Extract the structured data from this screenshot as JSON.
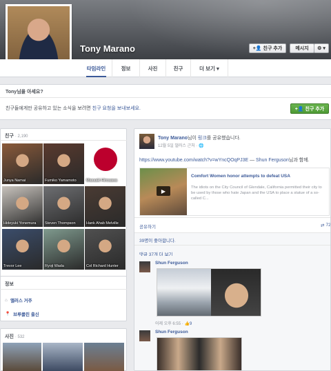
{
  "profile": {
    "name": "Tony Marano",
    "buttons": {
      "add_friend": "친구 추가",
      "message": "메시지",
      "gear_caret": "▾"
    }
  },
  "tabs": [
    {
      "label": "타임라인",
      "active": true
    },
    {
      "label": "정보"
    },
    {
      "label": "사진"
    },
    {
      "label": "친구"
    },
    {
      "label": "더 보기 ▾"
    }
  ],
  "know": {
    "title": "Tony님을 아세요?",
    "text_before": "친구들에게만 공유하고 있는 소식을 보려면 ",
    "link": "친구 요청을 보내보세요.",
    "add_friend": "친구 추가"
  },
  "friends": {
    "title": "친구",
    "count": "· 2,190",
    "items": [
      {
        "name": "Junya Namai",
        "color": "#8a5a3a"
      },
      {
        "name": "Fumiko Yamamoto",
        "color": "#5a3a2e"
      },
      {
        "name": "Masaaki Hirosawa",
        "color": "#ffffff"
      },
      {
        "name": "Hideyuki Yonemura",
        "color": "#c7c2bc"
      },
      {
        "name": "Steven Thompson",
        "color": "#6e6f72"
      },
      {
        "name": "Hank Ahab Melville",
        "color": "#4a3b33"
      },
      {
        "name": "Trevor Lee",
        "color": "#3b4d6b"
      },
      {
        "name": "Ryoji Wada",
        "color": "#7f9a8e"
      },
      {
        "name": "Col Richard Hunter",
        "color": "#505050"
      }
    ]
  },
  "info": {
    "title": "정보",
    "lives_prefix": "앨러스 거주",
    "from": "브루클린 출신"
  },
  "photos": {
    "title": "사진",
    "count": "· 532"
  },
  "post": {
    "author": "Tony Marano",
    "action_middle": "님이 ",
    "action_link": "링크",
    "action_end": "를 공유했습니다.",
    "time": "12월 5일 댈러스 근처 · ",
    "url": "https://www.youtube.com/watch?v=wYncQOqPJ3E",
    "with_sep": " — ",
    "with_name": "Shun Ferguson",
    "with_end": "님과 함께.",
    "preview_title": "Comfort Women honor attempts to defeat USA",
    "preview_desc": "The idiots on the City Council of Glendale, California permitted their city to be used by those who hate Japan and the USA to place a statue of a so-called C...",
    "share": "공유하기",
    "share_count": "72",
    "likes": "39명이 좋아합니다.",
    "more_comments": "댓글 37개 더 보기",
    "comments": [
      {
        "author": "Shun Ferguson",
        "meta": "어제 오후 6:55 · ",
        "likes": "9"
      },
      {
        "author": "Shun Ferguson"
      }
    ]
  }
}
